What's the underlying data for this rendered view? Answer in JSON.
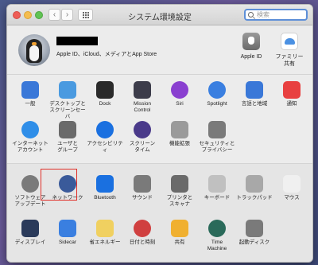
{
  "window": {
    "title": "システム環境設定"
  },
  "search": {
    "placeholder": "検索"
  },
  "user": {
    "subtitle": "Apple ID、iCloud、メディアとApp Store"
  },
  "top_items": [
    {
      "label": "Apple ID",
      "icon": "apple-id-icon"
    },
    {
      "label": "ファミリー\n共有",
      "icon": "family-sharing-icon"
    }
  ],
  "row1": [
    {
      "label": "一般",
      "icon": "general-icon",
      "color": "#3a78d8"
    },
    {
      "label": "デスクトップと\nスクリーンセーバ",
      "icon": "desktop-screensaver-icon",
      "color": "#4a9ae0"
    },
    {
      "label": "Dock",
      "icon": "dock-icon",
      "color": "#2a2a2a"
    },
    {
      "label": "Mission\nControl",
      "icon": "mission-control-icon",
      "color": "#3c3c4a"
    },
    {
      "label": "Siri",
      "icon": "siri-icon",
      "color": "#8a40d0"
    },
    {
      "label": "Spotlight",
      "icon": "spotlight-icon",
      "color": "#3a7fe0"
    },
    {
      "label": "言語と地域",
      "icon": "language-region-icon",
      "color": "#3a78d8"
    },
    {
      "label": "通知",
      "icon": "notifications-icon",
      "color": "#e84040"
    }
  ],
  "row2": [
    {
      "label": "インターネット\nアカウント",
      "icon": "internet-accounts-icon",
      "color": "#2f8ee8"
    },
    {
      "label": "ユーザと\nグループ",
      "icon": "users-groups-icon",
      "color": "#6a6a6a"
    },
    {
      "label": "アクセシビリティ",
      "icon": "accessibility-icon",
      "color": "#1a70e0"
    },
    {
      "label": "スクリーン\nタイム",
      "icon": "screen-time-icon",
      "color": "#4a3a8a"
    },
    {
      "label": "機能拡張",
      "icon": "extensions-icon",
      "color": "#9a9a9a"
    },
    {
      "label": "セキュリティと\nプライバシー",
      "icon": "security-privacy-icon",
      "color": "#7a7a7a"
    }
  ],
  "row3": [
    {
      "label": "ソフトウェア\nアップデート",
      "icon": "software-update-icon",
      "color": "#7a7a7a"
    },
    {
      "label": "ネットワーク",
      "icon": "network-icon",
      "color": "#3a5a9a"
    },
    {
      "label": "Bluetooth",
      "icon": "bluetooth-icon",
      "color": "#1a70e0"
    },
    {
      "label": "サウンド",
      "icon": "sound-icon",
      "color": "#7a7a7a"
    },
    {
      "label": "プリンタと\nスキャナ",
      "icon": "printers-scanners-icon",
      "color": "#6a6a6a"
    },
    {
      "label": "キーボード",
      "icon": "keyboard-icon",
      "color": "#c0c0c0"
    },
    {
      "label": "トラックパッド",
      "icon": "trackpad-icon",
      "color": "#a8a8a8"
    },
    {
      "label": "マウス",
      "icon": "mouse-icon",
      "color": "#f0f0f0"
    }
  ],
  "row4": [
    {
      "label": "ディスプレイ",
      "icon": "displays-icon",
      "color": "#2a3a5a"
    },
    {
      "label": "Sidecar",
      "icon": "sidecar-icon",
      "color": "#3a7fe0"
    },
    {
      "label": "省エネルギー",
      "icon": "energy-saver-icon",
      "color": "#f0d060"
    },
    {
      "label": "日付と時刻",
      "icon": "date-time-icon",
      "color": "#d04040"
    },
    {
      "label": "共有",
      "icon": "sharing-icon",
      "color": "#f0b030"
    },
    {
      "label": "Time\nMachine",
      "icon": "time-machine-icon",
      "color": "#2a6a5a"
    },
    {
      "label": "起動ディスク",
      "icon": "startup-disk-icon",
      "color": "#7a7a7a"
    }
  ]
}
